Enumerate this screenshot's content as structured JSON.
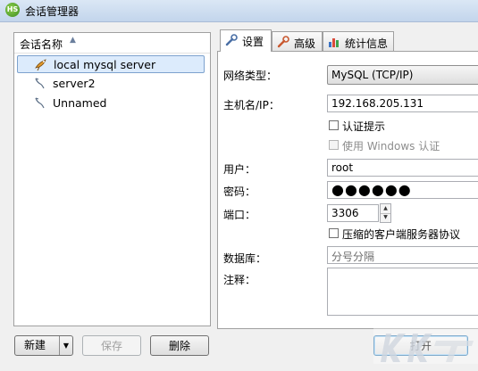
{
  "window": {
    "title": "会话管理器",
    "icon_label": "HS"
  },
  "tree": {
    "header": "会话名称",
    "items": [
      {
        "label": "local mysql server",
        "selected": true,
        "icon": "dolphin-active-icon"
      },
      {
        "label": "server2",
        "selected": false,
        "icon": "dolphin-icon"
      },
      {
        "label": "Unnamed",
        "selected": false,
        "icon": "dolphin-icon"
      }
    ]
  },
  "tabs": [
    {
      "label": "设置",
      "icon": "wrench-icon",
      "active": true
    },
    {
      "label": "高级",
      "icon": "wrench-red-icon",
      "active": false
    },
    {
      "label": "统计信息",
      "icon": "bar-chart-icon",
      "active": false
    }
  ],
  "form": {
    "network_type": {
      "label": "网络类型：",
      "value": "MySQL (TCP/IP)"
    },
    "host": {
      "label": "主机名/IP：",
      "value": "192.168.205.131"
    },
    "auth_prompt": {
      "label": "认证提示",
      "checked": false
    },
    "windows_auth": {
      "label": "使用 Windows 认证",
      "checked": false,
      "disabled": true
    },
    "user": {
      "label": "用户：",
      "value": "root"
    },
    "password": {
      "label": "密码：",
      "value": "●●●●●●"
    },
    "port": {
      "label": "端口：",
      "value": "3306"
    },
    "compression": {
      "label": "压缩的客户端服务器协议",
      "checked": false
    },
    "database": {
      "label": "数据库：",
      "placeholder": "分号分隔"
    },
    "comment": {
      "label": "注释：",
      "value": ""
    }
  },
  "buttons": {
    "new": "新建",
    "save": "保存",
    "delete": "删除",
    "open": "打开"
  },
  "colors": {
    "selection": "#dcebfc",
    "selection_border": "#7da2ce",
    "titlebar": "#c3d5ec"
  }
}
